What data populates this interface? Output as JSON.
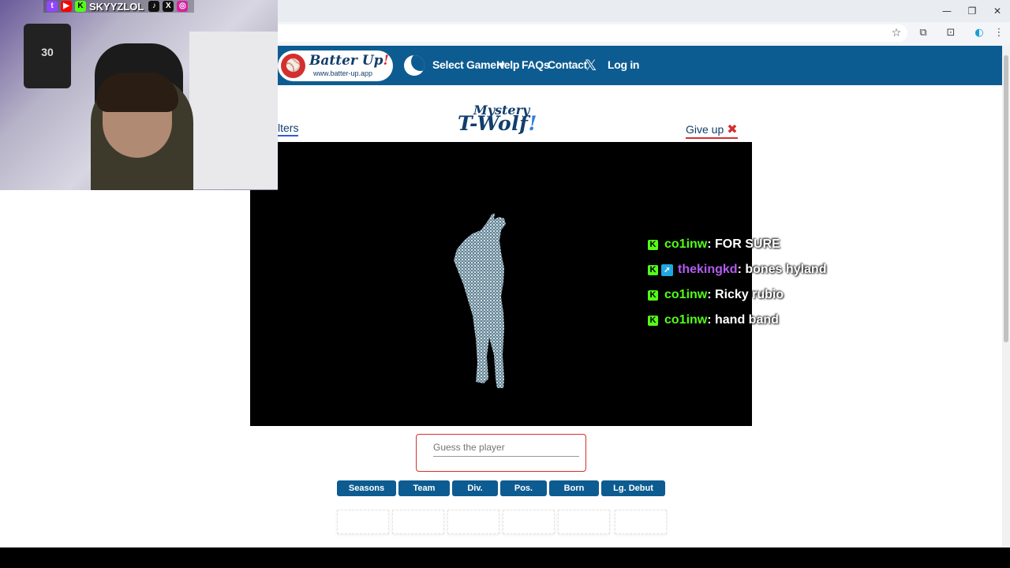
{
  "browser": {
    "window_controls": {
      "minimize": "—",
      "restore": "❐",
      "close": "✕"
    },
    "toolbar_icons": {
      "star": "☆",
      "extensions": "⧉",
      "screen": "⊡",
      "profile": "◐",
      "menu": "⋮"
    }
  },
  "nav": {
    "logo_title": "Batter Up",
    "logo_bang": "!",
    "logo_url": "www.batter-up.app",
    "links": [
      "Select Game ▾",
      "Help",
      "FAQs",
      "Contact",
      "Log in"
    ],
    "x_symbol": "𝕏"
  },
  "game": {
    "title_line1": "Mystery",
    "title_line2": "T-Wolf",
    "title_bang": "!",
    "filters_label": "lters",
    "give_up_label": "Give up",
    "give_up_icon": "✖"
  },
  "chat": [
    {
      "user": "co1inw",
      "message": " : FOR SURE",
      "color": "#53fc18",
      "has_badge": false
    },
    {
      "user": "thekingkd",
      "message": " : bones hyland",
      "color": "#b05cf0",
      "has_badge": true
    },
    {
      "user": "co1inw",
      "message": " : Ricky rubio",
      "color": "#53fc18",
      "has_badge": false
    },
    {
      "user": "co1inw",
      "message": " : hand band",
      "color": "#53fc18",
      "has_badge": false
    }
  ],
  "guess": {
    "placeholder": "Guess the player",
    "value": ""
  },
  "columns": [
    "Seasons",
    "Team",
    "Div.",
    "Pos.",
    "Born",
    "Lg. Debut"
  ],
  "overlay": {
    "streamer_name": "SKYYZLOL",
    "jersey_number": "30"
  },
  "colors": {
    "nav_blue": "#0d5c91",
    "accent_red": "#d32f2f",
    "kick_green": "#53fc18"
  }
}
